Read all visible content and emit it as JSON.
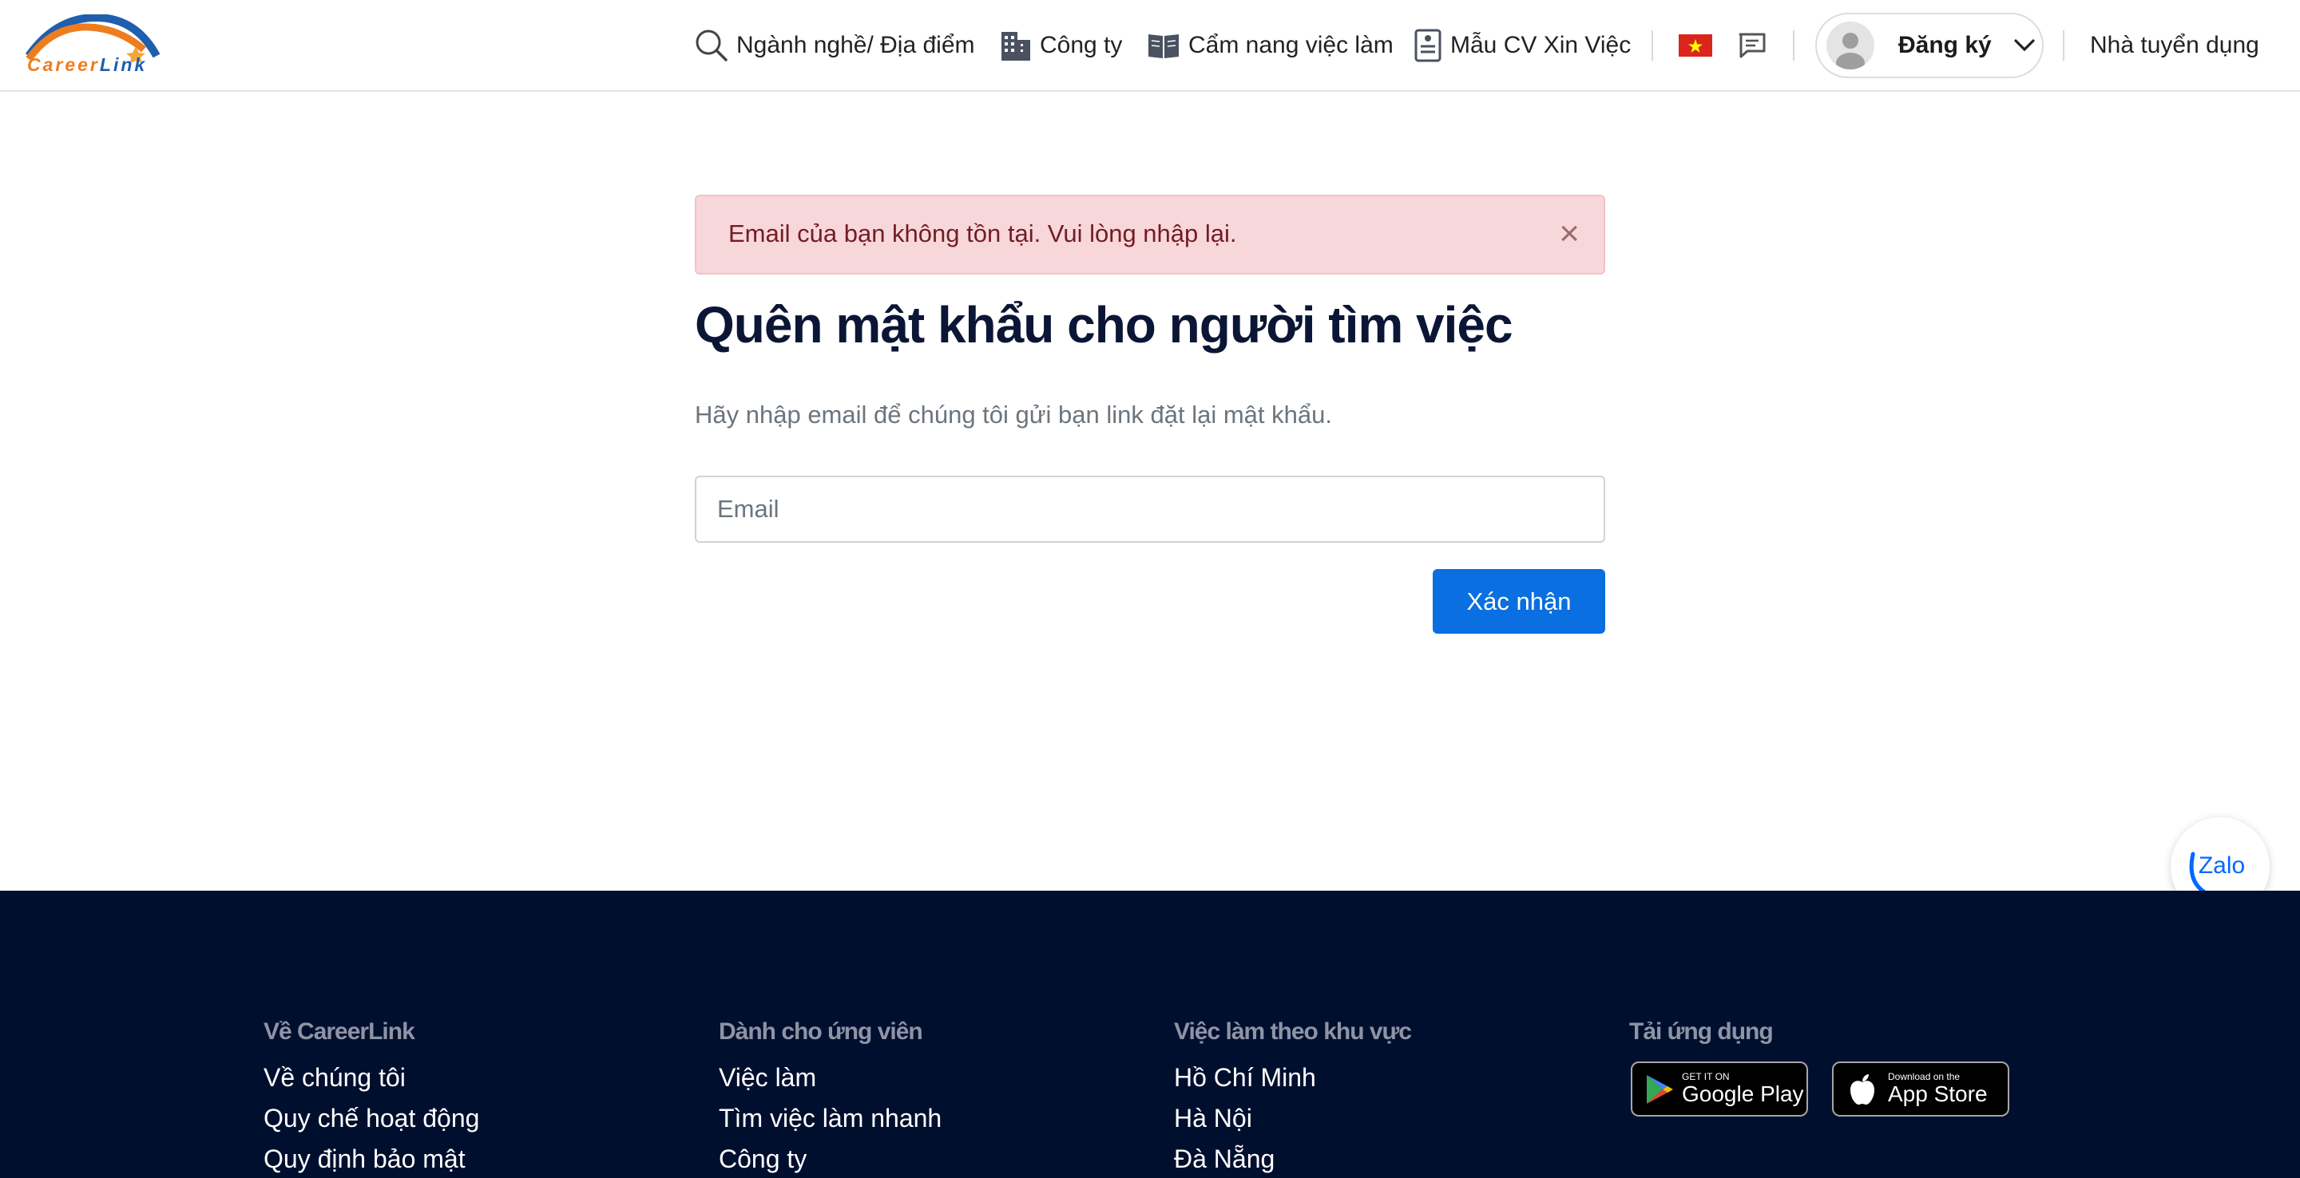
{
  "header": {
    "logo": {
      "part1": "Career",
      "part2": "Link"
    },
    "nav": {
      "industry_location": "Ngành nghề/ Địa điểm",
      "company": "Công ty",
      "handbook": "Cẩm nang việc làm",
      "cv_template": "Mẫu CV Xin Việc"
    },
    "language_flag": "vietnam-flag",
    "signup_label": "Đăng ký",
    "employer_link": "Nhà tuyển dụng"
  },
  "alert": {
    "message": "Email của bạn không tồn tại. Vui lòng nhập lại.",
    "close_symbol": "×"
  },
  "form": {
    "title": "Quên mật khẩu cho người tìm việc",
    "description": "Hãy nhập email để chúng tôi gửi bạn link đặt lại mật khẩu.",
    "email_placeholder": "Email",
    "email_value": "",
    "submit_label": "Xác nhận"
  },
  "zalo_label": "Zalo",
  "footer": {
    "about": {
      "heading": "Về CareerLink",
      "links": [
        "Về chúng tôi",
        "Quy chế hoạt động",
        "Quy định bảo mật"
      ]
    },
    "candidates": {
      "heading": "Dành cho ứng viên",
      "links": [
        "Việc làm",
        "Tìm việc làm nhanh",
        "Công ty"
      ]
    },
    "regions": {
      "heading": "Việc làm theo khu vực",
      "links": [
        "Hồ Chí Minh",
        "Hà Nội",
        "Đà Nẵng"
      ]
    },
    "apps": {
      "heading": "Tải ứng dụng",
      "google_play": {
        "small": "GET IT ON",
        "big": "Google Play"
      },
      "app_store": {
        "small": "Download on the",
        "big": "App Store"
      }
    }
  },
  "colors": {
    "primary": "#0a6fe0",
    "alert_bg": "#f8d7da",
    "alert_text": "#721c24",
    "title": "#0b1636",
    "footer_bg": "#010f2e"
  }
}
